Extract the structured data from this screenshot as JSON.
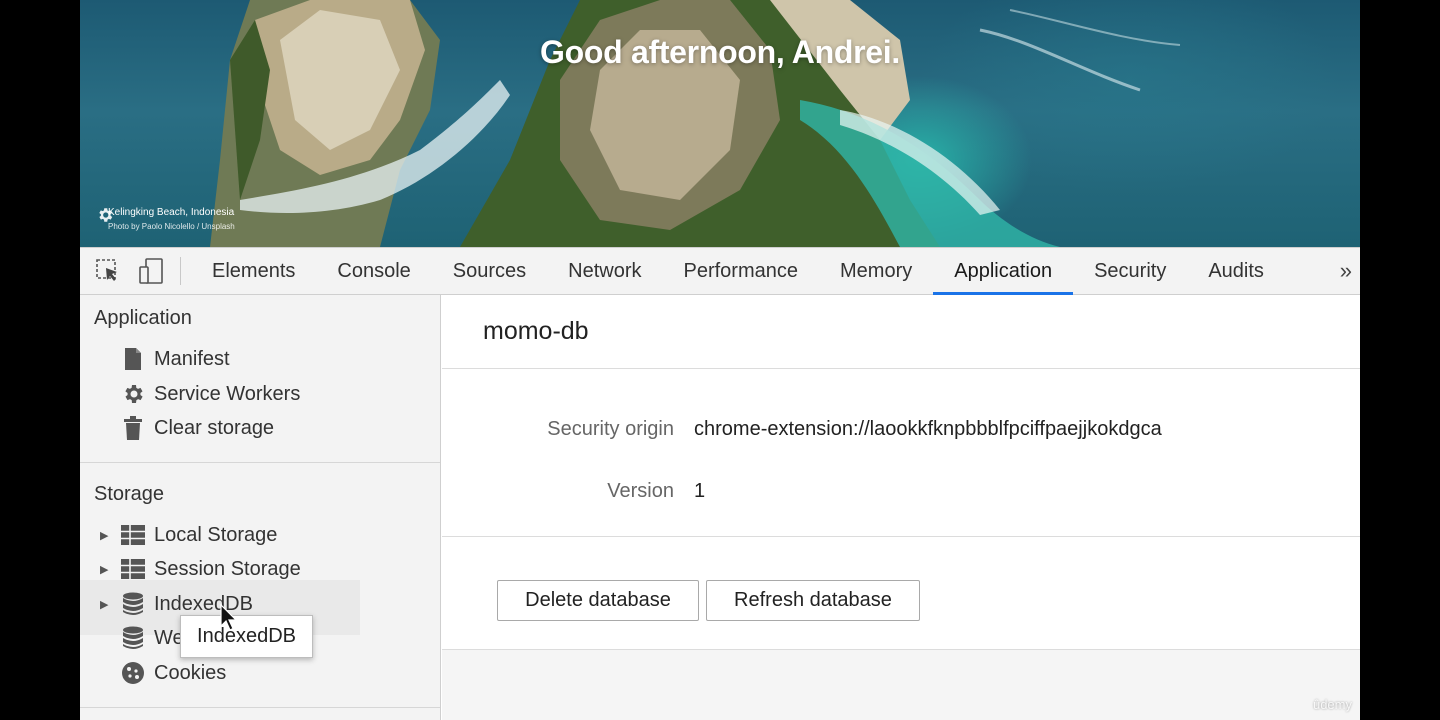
{
  "hero": {
    "greeting": "Good afternoon, Andrei.",
    "location": "Kelingking Beach, Indonesia",
    "credit": "Photo by Paolo Nicolello / Unsplash",
    "settings_icon": "gear-icon"
  },
  "toolbar": {
    "inspect_icon": "inspect-element-icon",
    "device_icon": "device-toolbar-icon",
    "tabs": [
      {
        "label": "Elements"
      },
      {
        "label": "Console"
      },
      {
        "label": "Sources"
      },
      {
        "label": "Network"
      },
      {
        "label": "Performance"
      },
      {
        "label": "Memory"
      },
      {
        "label": "Application",
        "active": true
      },
      {
        "label": "Security"
      },
      {
        "label": "Audits"
      }
    ],
    "more": "»",
    "active_color": "#1a73e8"
  },
  "sidebar": {
    "application_title": "Application",
    "application_items": [
      {
        "label": "Manifest",
        "icon": "file-icon"
      },
      {
        "label": "Service Workers",
        "icon": "gear-icon"
      },
      {
        "label": "Clear storage",
        "icon": "trash-icon"
      }
    ],
    "storage_title": "Storage",
    "storage_items": [
      {
        "label": "Local Storage",
        "icon": "grid-icon"
      },
      {
        "label": "Session Storage",
        "icon": "grid-icon"
      },
      {
        "label": "IndexedDB",
        "icon": "database-icon"
      },
      {
        "label": "Web SQL",
        "icon": "database-icon"
      },
      {
        "label": "Cookies",
        "icon": "cookie-icon"
      }
    ],
    "tooltip": "IndexedDB"
  },
  "main": {
    "db_name": "momo-db",
    "security_origin_label": "Security origin",
    "security_origin_value": "chrome-extension://laookkfknpbbblfpciffpaejjkokdgca",
    "version_label": "Version",
    "version_value": "1",
    "delete_button": "Delete database",
    "refresh_button": "Refresh database"
  },
  "watermark": "ûdemy"
}
